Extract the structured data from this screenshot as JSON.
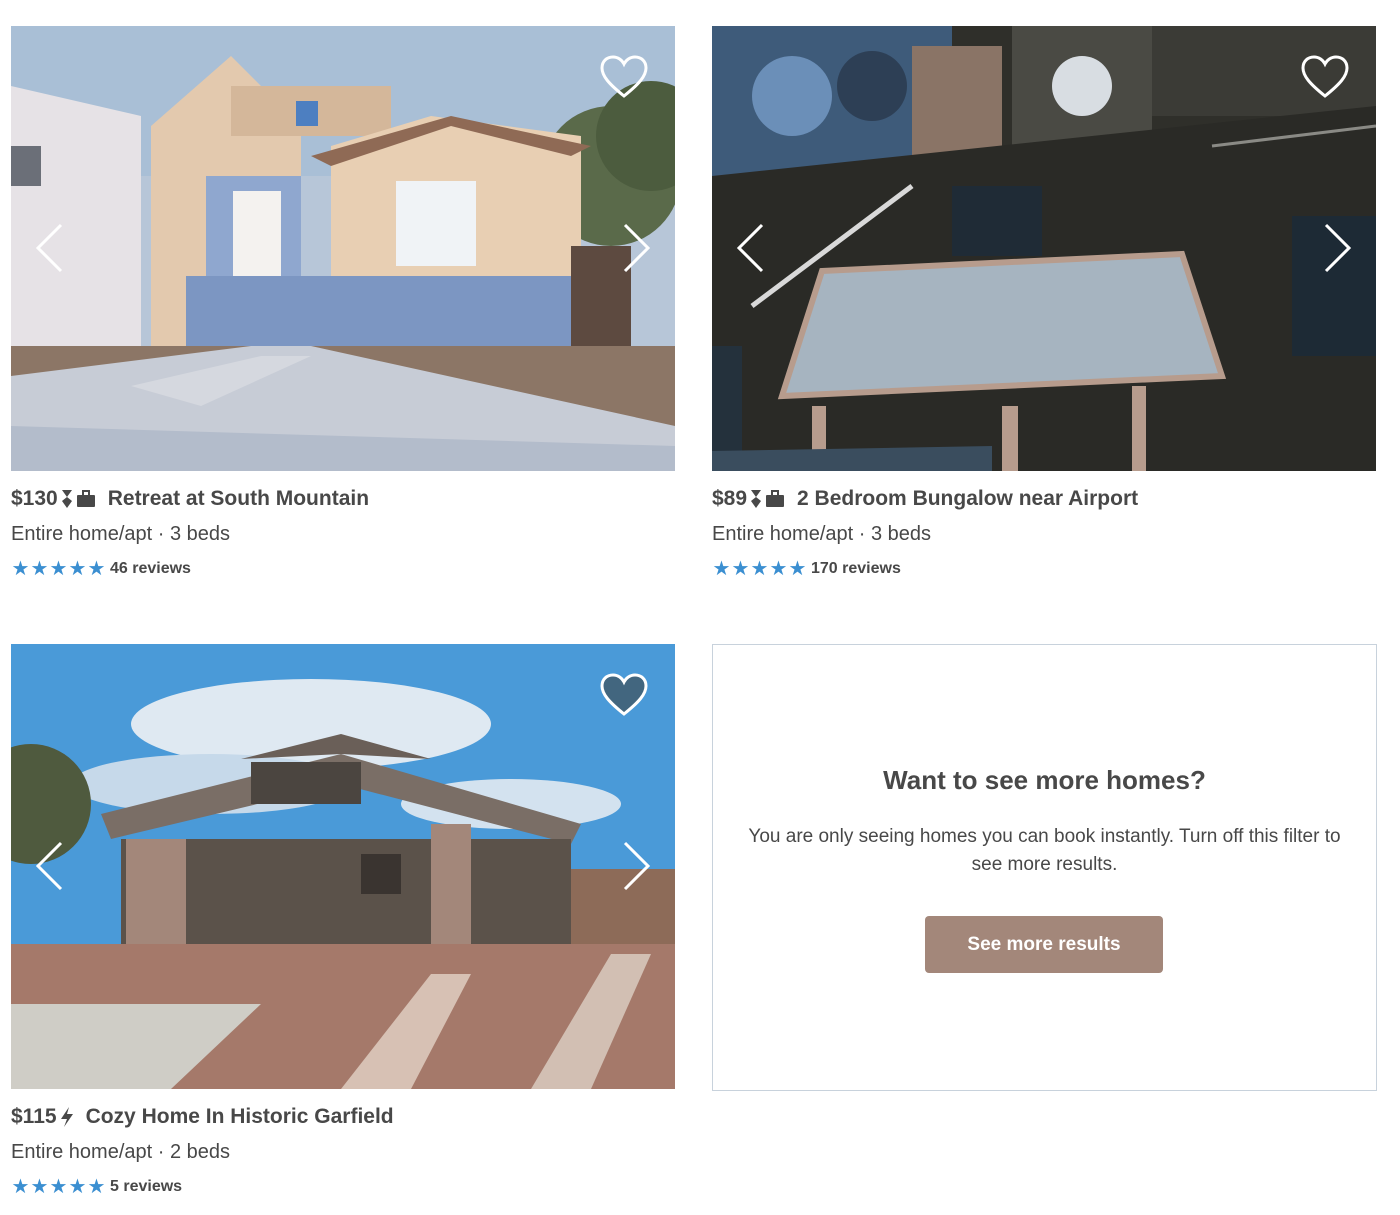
{
  "listings": [
    {
      "price": "$130",
      "name": "Retreat at South Mountain",
      "room_type": "Entire home/apt · 3 beds",
      "rating_stars": 5,
      "reviews": "46 reviews",
      "badges": [
        "superhost-icon",
        "business-travel-icon"
      ]
    },
    {
      "price": "$89",
      "name": "2 Bedroom Bungalow near Airport",
      "room_type": "Entire home/apt · 3 beds",
      "rating_stars": 5,
      "reviews": "170 reviews",
      "badges": [
        "superhost-icon",
        "business-travel-icon"
      ]
    },
    {
      "price": "$115",
      "name": "Cozy Home In Historic Garfield",
      "room_type": "Entire home/apt · 2 beds",
      "rating_stars": 5,
      "reviews": "5 reviews",
      "badges": [
        "instant-book-icon"
      ]
    }
  ],
  "promo": {
    "title": "Want to see more homes?",
    "text": "You are only seeing homes you can book instantly. Turn off this filter to see more results.",
    "button": "See more results"
  },
  "colors": {
    "star": "#3b8fd1",
    "button": "#a3877a",
    "text": "#484848"
  }
}
